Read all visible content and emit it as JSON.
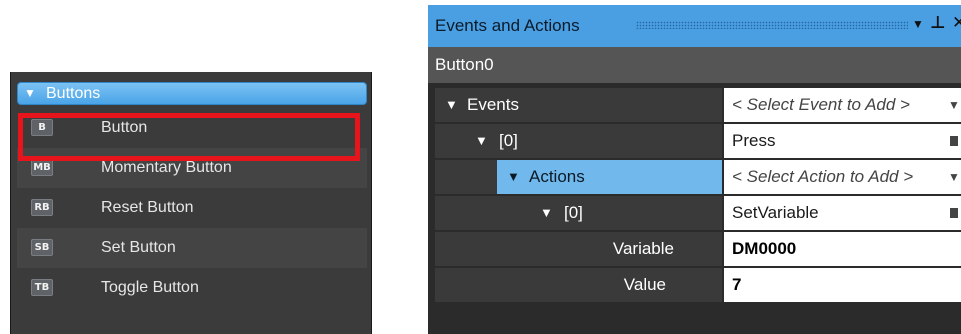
{
  "toolbox": {
    "group_title": "Buttons",
    "items": [
      {
        "badge": "B",
        "label": "Button"
      },
      {
        "badge": "MB",
        "label": "Momentary Button"
      },
      {
        "badge": "RB",
        "label": "Reset Button"
      },
      {
        "badge": "SB",
        "label": "Set Button"
      },
      {
        "badge": "TB",
        "label": "Toggle Button"
      }
    ]
  },
  "panel": {
    "title": "Events and Actions",
    "controls": {
      "dropdown": "▼",
      "pin": "⊥",
      "close": "✕"
    },
    "object_name": "Button0",
    "rows": {
      "events": {
        "label": "Events",
        "value": "< Select Event to Add >"
      },
      "event0": {
        "label": "[0]",
        "value": "Press"
      },
      "actions": {
        "label": "Actions",
        "value": "< Select Action to Add >"
      },
      "action0": {
        "label": "[0]",
        "value": "SetVariable"
      },
      "variable": {
        "label": "Variable",
        "value": "DM0000"
      },
      "value": {
        "label": "Value",
        "value": "7"
      }
    }
  },
  "colors": {
    "accent": "#4a9fe3",
    "highlight": "#71b8ec",
    "selection_box": "#e8141b"
  }
}
